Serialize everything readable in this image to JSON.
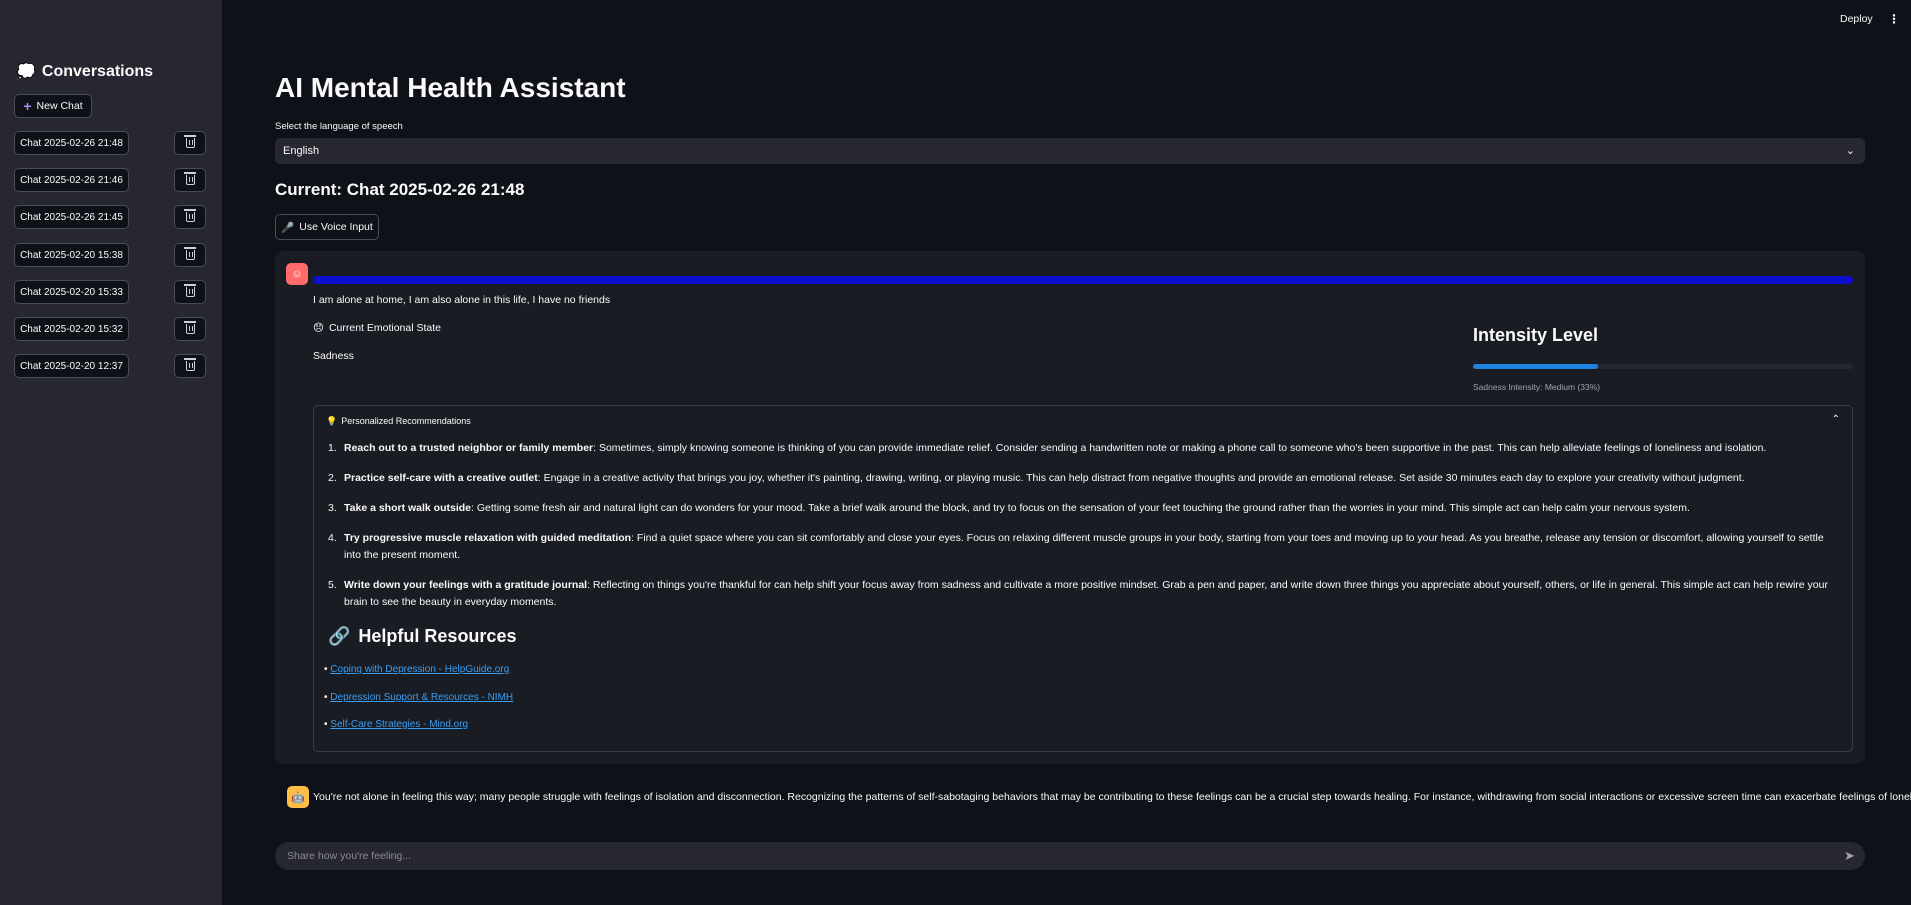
{
  "sidebar": {
    "title": "Conversations",
    "title_icon": "speech-bubble-icon",
    "new_chat_label": "New Chat",
    "chats": [
      "Chat 2025-02-26 21:48",
      "Chat 2025-02-26 21:46",
      "Chat 2025-02-26 21:45",
      "Chat 2025-02-20 15:38",
      "Chat 2025-02-20 15:33",
      "Chat 2025-02-20 15:32",
      "Chat 2025-02-20 12:37"
    ]
  },
  "header": {
    "deploy_label": "Deploy",
    "menu_icon": "⋮"
  },
  "main": {
    "title": "AI Mental Health Assistant",
    "language_label": "Select the language of speech",
    "language_value": "English",
    "current_chat": "Current: Chat 2025-02-26 21:48",
    "voice_button": "Use Voice Input"
  },
  "message": {
    "user_text": "I am alone at home, I am also alone in this life, I have no friends",
    "emotion_header": "Current Emotional State",
    "emotion_value": "Sadness",
    "intensity_title": "Intensity Level",
    "intensity_percent": 33,
    "intensity_caption": "Sadness Intensity: Medium (33%)"
  },
  "recommendations": {
    "header": "Personalized Recommendations",
    "items": [
      {
        "num": "1.",
        "title": "Reach out to a trusted neighbor or family member",
        "body": ": Sometimes, simply knowing someone is thinking of you can provide immediate relief. Consider sending a handwritten note or making a phone call to someone who's been supportive in the past. This can help alleviate feelings of loneliness and isolation."
      },
      {
        "num": "2.",
        "title": "Practice self-care with a creative outlet",
        "body": ": Engage in a creative activity that brings you joy, whether it's painting, drawing, writing, or playing music. This can help distract from negative thoughts and provide an emotional release. Set aside 30 minutes each day to explore your creativity without judgment."
      },
      {
        "num": "3.",
        "title": "Take a short walk outside",
        "body": ": Getting some fresh air and natural light can do wonders for your mood. Take a brief walk around the block, and try to focus on the sensation of your feet touching the ground rather than the worries in your mind. This simple act can help calm your nervous system."
      },
      {
        "num": "4.",
        "title": "Try progressive muscle relaxation with guided meditation",
        "body": ": Find a quiet space where you can sit comfortably and close your eyes. Focus on relaxing different muscle groups in your body, starting from your toes and moving up to your head. As you breathe, release any tension or discomfort, allowing yourself to settle into the present moment."
      },
      {
        "num": "5.",
        "title": "Write down your feelings with a gratitude journal",
        "body": ": Reflecting on things you're thankful for can help shift your focus away from sadness and cultivate a more positive mindset. Grab a pen and paper, and write down three things you appreciate about yourself, others, or life in general. This simple act can help rewire your brain to see the beauty in everyday moments."
      }
    ],
    "resources_title": "Helpful Resources",
    "resources": [
      "Coping with Depression - HelpGuide.org",
      "Depression Support & Resources - NIMH",
      "Self-Care Strategies - Mind.org"
    ]
  },
  "bot": {
    "text": "You're not alone in feeling this way; many people struggle with feelings of isolation and disconnection. Recognizing the patterns of self-sabotaging behaviors that may be contributing to these feelings can be a crucial step towards healing. For instance, withdrawing from social interactions or excessive screen time can exacerbate feelings of loneliness."
  },
  "input": {
    "placeholder": "Share how you're feeling..."
  },
  "colors": {
    "accent": "#ff4b4b",
    "progress": "#0c0fd0",
    "intensity": "#1c83e1",
    "link": "#3a9df0"
  }
}
